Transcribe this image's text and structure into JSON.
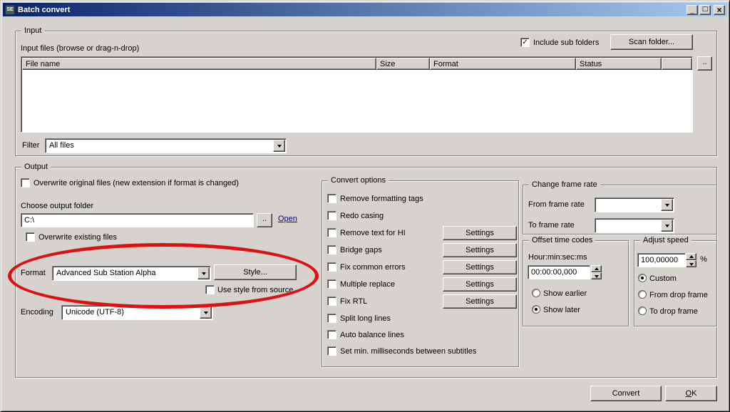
{
  "colors": {
    "face": "#d6d3ce",
    "titlebar-start": "#0a246a",
    "titlebar-end": "#a6caf0",
    "title-text": "#ffffff",
    "link": "#0000cc",
    "annotation": "#dd1111"
  },
  "icons": {
    "check": "✓",
    "minimize": "_",
    "maximize": "□",
    "close": "×",
    "dropdown": "▼"
  },
  "window": {
    "title": "Batch convert",
    "icon_text": "SE"
  },
  "input": {
    "group_title": "Input",
    "include_sub_folders_label": "Include sub folders",
    "include_sub_folders_checked": true,
    "scan_folder_button": "Scan folder...",
    "files_label": "Input files (browse or drag-n-drop)",
    "columns": [
      "File name",
      "Size",
      "Format",
      "Status"
    ],
    "browse_button": "..",
    "filter_label": "Filter",
    "filter_value": "All files"
  },
  "output": {
    "group_title": "Output",
    "overwrite_original_label": "Overwrite original files (new extension if format is changed)",
    "overwrite_original_checked": false,
    "choose_folder_label": "Choose output folder",
    "folder_value": "C:\\",
    "browse_button": "..",
    "open_link": "Open",
    "overwrite_existing_label": "Overwrite existing files",
    "overwrite_existing_checked": false,
    "format_label": "Format",
    "format_value": "Advanced Sub Station Alpha",
    "style_button": "Style...",
    "use_style_label": "Use style from source",
    "use_style_checked": false,
    "encoding_label": "Encoding",
    "encoding_value": "Unicode (UTF-8)"
  },
  "convert_options": {
    "group_title": "Convert options",
    "settings_button": "Settings",
    "options": [
      {
        "label": "Remove formatting tags",
        "checked": false,
        "settings": false
      },
      {
        "label": "Redo casing",
        "checked": false,
        "settings": false
      },
      {
        "label": "Remove text for HI",
        "checked": false,
        "settings": true
      },
      {
        "label": "Bridge gaps",
        "checked": false,
        "settings": true
      },
      {
        "label": "Fix common errors",
        "checked": false,
        "settings": true
      },
      {
        "label": "Multiple replace",
        "checked": false,
        "settings": true
      },
      {
        "label": "Fix RTL",
        "checked": false,
        "settings": true
      },
      {
        "label": "Split long lines",
        "checked": false,
        "settings": false
      },
      {
        "label": "Auto balance lines",
        "checked": false,
        "settings": false
      },
      {
        "label": "Set min. milliseconds between subtitles",
        "checked": false,
        "settings": false
      }
    ]
  },
  "frame_rate": {
    "group_title": "Change frame rate",
    "from_label": "From frame rate",
    "from_value": "",
    "to_label": "To frame rate",
    "to_value": ""
  },
  "offset": {
    "group_title": "Offset time codes",
    "format_label": "Hour:min:sec:ms",
    "value": "00:00:00,000",
    "show_earlier_label": "Show earlier",
    "show_later_label": "Show later",
    "selected": "Show later"
  },
  "adjust_speed": {
    "group_title": "Adjust speed",
    "value": "100,00000",
    "unit": "%",
    "custom_label": "Custom",
    "from_drop_label": "From drop frame",
    "to_drop_label": "To drop frame",
    "selected": "Custom"
  },
  "footer": {
    "convert_button": "Convert",
    "ok_button": "OK"
  }
}
